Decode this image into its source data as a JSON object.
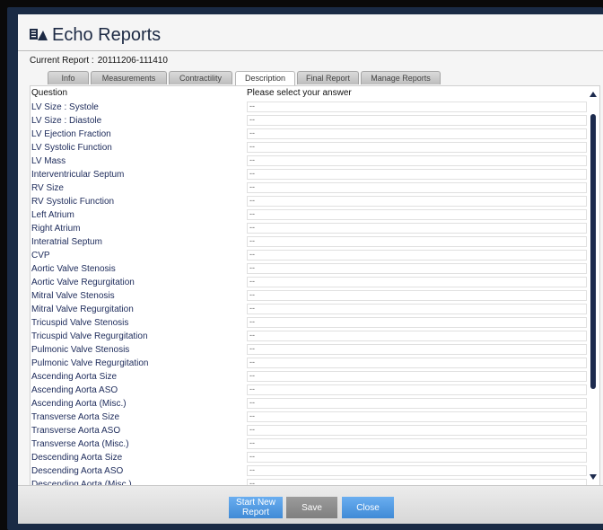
{
  "app": {
    "title": "Echo Reports"
  },
  "report": {
    "label": "Current Report :",
    "id": "20111206-111410"
  },
  "tabs": [
    {
      "label": "Info"
    },
    {
      "label": "Measurements"
    },
    {
      "label": "Contractility"
    },
    {
      "label": "Description"
    },
    {
      "label": "Final Report"
    },
    {
      "label": "Manage Reports"
    }
  ],
  "active_tab": "Description",
  "table": {
    "question_header": "Question",
    "answer_header": "Please select your answer",
    "rows": [
      {
        "question": "LV Size : Systole",
        "answer": "--"
      },
      {
        "question": "LV Size : Diastole",
        "answer": "--"
      },
      {
        "question": "LV Ejection Fraction",
        "answer": "--"
      },
      {
        "question": "LV Systolic Function",
        "answer": "--"
      },
      {
        "question": "LV Mass",
        "answer": "--"
      },
      {
        "question": "Interventricular Septum",
        "answer": "--"
      },
      {
        "question": "RV Size",
        "answer": "--"
      },
      {
        "question": "RV Systolic Function",
        "answer": "--"
      },
      {
        "question": "Left Atrium",
        "answer": "--"
      },
      {
        "question": "Right Atrium",
        "answer": "--"
      },
      {
        "question": "Interatrial Septum",
        "answer": "--"
      },
      {
        "question": "CVP",
        "answer": "--"
      },
      {
        "question": "Aortic Valve Stenosis",
        "answer": "--"
      },
      {
        "question": "Aortic Valve Regurgitation",
        "answer": "--"
      },
      {
        "question": "Mitral Valve Stenosis",
        "answer": "--"
      },
      {
        "question": "Mitral Valve Regurgitation",
        "answer": "--"
      },
      {
        "question": "Tricuspid Valve Stenosis",
        "answer": "--"
      },
      {
        "question": "Tricuspid Valve Regurgitation",
        "answer": "--"
      },
      {
        "question": "Pulmonic Valve Stenosis",
        "answer": "--"
      },
      {
        "question": "Pulmonic Valve Regurgitation",
        "answer": "--"
      },
      {
        "question": "Ascending Aorta Size",
        "answer": "--"
      },
      {
        "question": "Ascending Aorta ASO",
        "answer": "--"
      },
      {
        "question": "Ascending Aorta (Misc.)",
        "answer": "--"
      },
      {
        "question": "Transverse Aorta Size",
        "answer": "--"
      },
      {
        "question": "Transverse Aorta ASO",
        "answer": "--"
      },
      {
        "question": "Transverse Aorta (Misc.)",
        "answer": "--"
      },
      {
        "question": "Descending Aorta Size",
        "answer": "--"
      },
      {
        "question": "Descending Aorta ASO",
        "answer": "--"
      },
      {
        "question": "Descending Aorta (Misc.)",
        "answer": "--"
      }
    ]
  },
  "buttons": {
    "start_new_line1": "Start New",
    "start_new_line2": "Report",
    "save": "Save",
    "close": "Close"
  },
  "icons": {
    "app": "reports-icon",
    "scroll_up": "arrow-up-icon",
    "scroll_down": "arrow-down-icon"
  },
  "colors": {
    "accent": "#3f8ad6",
    "title": "#1d2a44",
    "frame": "#1a2b45",
    "scrollbar": "#1d2b4e"
  }
}
